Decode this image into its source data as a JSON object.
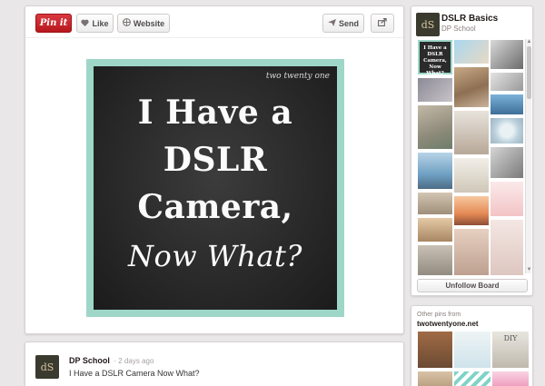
{
  "toolbar": {
    "pin_it_label": "Pin it",
    "like_label": "Like",
    "website_label": "Website",
    "send_label": "Send",
    "icons": {
      "like": "heart-icon",
      "website": "globe-icon",
      "send": "paper-plane-icon",
      "share": "share-icon"
    }
  },
  "pin": {
    "credit": "two twenty one",
    "lines": [
      "I Have a",
      "DSLR",
      "Camera,",
      "Now What?"
    ],
    "colors": {
      "border": "#9ed7c8",
      "chalkboard": "#2a2a2a"
    }
  },
  "comment": {
    "avatar_text": "dS",
    "user": "DP School",
    "time": "· 2 days ago",
    "text": "I Have a DSLR Camera Now What?"
  },
  "board": {
    "avatar_text": "dS",
    "title": "DSLR Basics",
    "owner": "DP School",
    "thumb_text": [
      "I Have a DSLR Camera, Now What?"
    ],
    "unfollow_label": "Unfollow Board"
  },
  "other_pins": {
    "label": "Other pins from",
    "site": "twotwentyone.net",
    "thumb_text": [
      "DIY"
    ]
  }
}
